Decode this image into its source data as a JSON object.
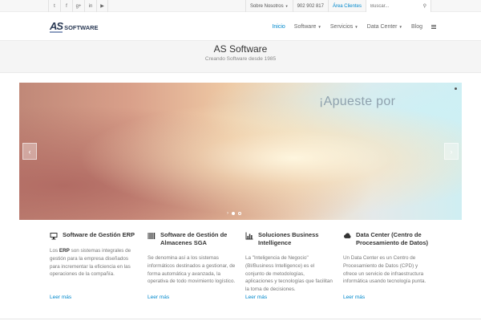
{
  "topbar": {
    "social": [
      {
        "icon": "twitter-icon",
        "glyph": "t"
      },
      {
        "icon": "facebook-icon",
        "glyph": "f"
      },
      {
        "icon": "google-plus-icon",
        "glyph": "g+"
      },
      {
        "icon": "linkedin-icon",
        "glyph": "in"
      },
      {
        "icon": "youtube-icon",
        "glyph": "▶"
      }
    ],
    "about_label": "Sobre Nosotros",
    "phone": "902 902 817",
    "clients_label": "Área Clientes",
    "search_placeholder": "Buscar..."
  },
  "header": {
    "logo_as": "AS",
    "logo_text": "SOFTWARE",
    "nav": [
      {
        "label": "Inicio",
        "active": true,
        "dropdown": false
      },
      {
        "label": "Software",
        "active": false,
        "dropdown": true
      },
      {
        "label": "Servicios",
        "active": false,
        "dropdown": true
      },
      {
        "label": "Data Center",
        "active": false,
        "dropdown": true
      },
      {
        "label": "Blog",
        "active": false,
        "dropdown": false
      }
    ]
  },
  "band": {
    "title": "AS Software",
    "subtitle": "Creando Software desde 1985"
  },
  "slider": {
    "headline": "¡Apueste por",
    "prev": "‹",
    "next": "›",
    "pager_next": "›"
  },
  "features": [
    {
      "icon": "monitor-icon",
      "title": "Software de Gestión ERP",
      "desc_prefix": "Los ",
      "desc_bold": "ERP",
      "desc_rest": " son sistemas integrales de gestión para la empresa diseñados para incrementar la eficiencia en las operaciones de la compañía.",
      "more": "Leer más"
    },
    {
      "icon": "barcode-icon",
      "title": "Software de Gestión de Almacenes SGA",
      "desc_prefix": "",
      "desc_bold": "",
      "desc_rest": "Se denomina así a los sistemas informáticos destinados a gestionar, de forma automática y avanzada, la operativa de todo movimiento logístico.",
      "more": "Leer más"
    },
    {
      "icon": "bar-chart-icon",
      "title": "Soluciones Business Intelligence",
      "desc_prefix": "",
      "desc_bold": "",
      "desc_rest": "La \"Inteligencia de Negocio\" (BI/Business Intelligence) es el conjunto de metodologías, aplicaciones y tecnologías que facilitan la toma de decisiones.",
      "more": "Leer más"
    },
    {
      "icon": "cloud-icon",
      "title": "Data Center (Centro de Procesamiento de Datos)",
      "desc_prefix": "",
      "desc_bold": "",
      "desc_rest": "Un Data Center es un Centro de Procesamiento de Datos (CPD) y ofrece un servicio de infraestructura informática usando tecnología punta.",
      "more": "Leer más"
    }
  ]
}
